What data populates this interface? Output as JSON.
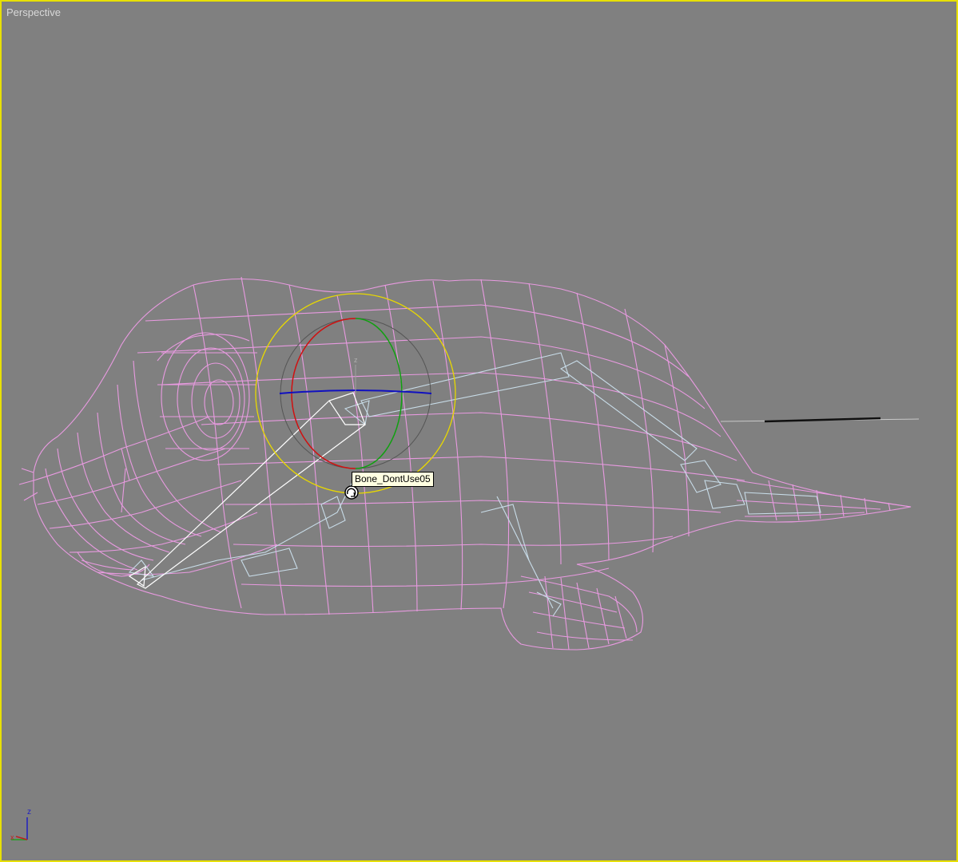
{
  "viewport": {
    "label": "Perspective",
    "border_color": "#e8e000",
    "background_color": "#808080"
  },
  "mesh": {
    "wire_color": "#e89ae0",
    "bone_color": "#c8dce8",
    "selected_bone_color": "#ffffff"
  },
  "gizmo": {
    "type": "rotate",
    "axis_label": "z",
    "colors": {
      "x": "#d01010",
      "y": "#10a010",
      "z": "#1010c0",
      "screen": "#e8d800"
    }
  },
  "tooltip": {
    "text": "Bone_DontUse05"
  },
  "axis_tripod": {
    "z_label": "z",
    "x_label": "x"
  }
}
